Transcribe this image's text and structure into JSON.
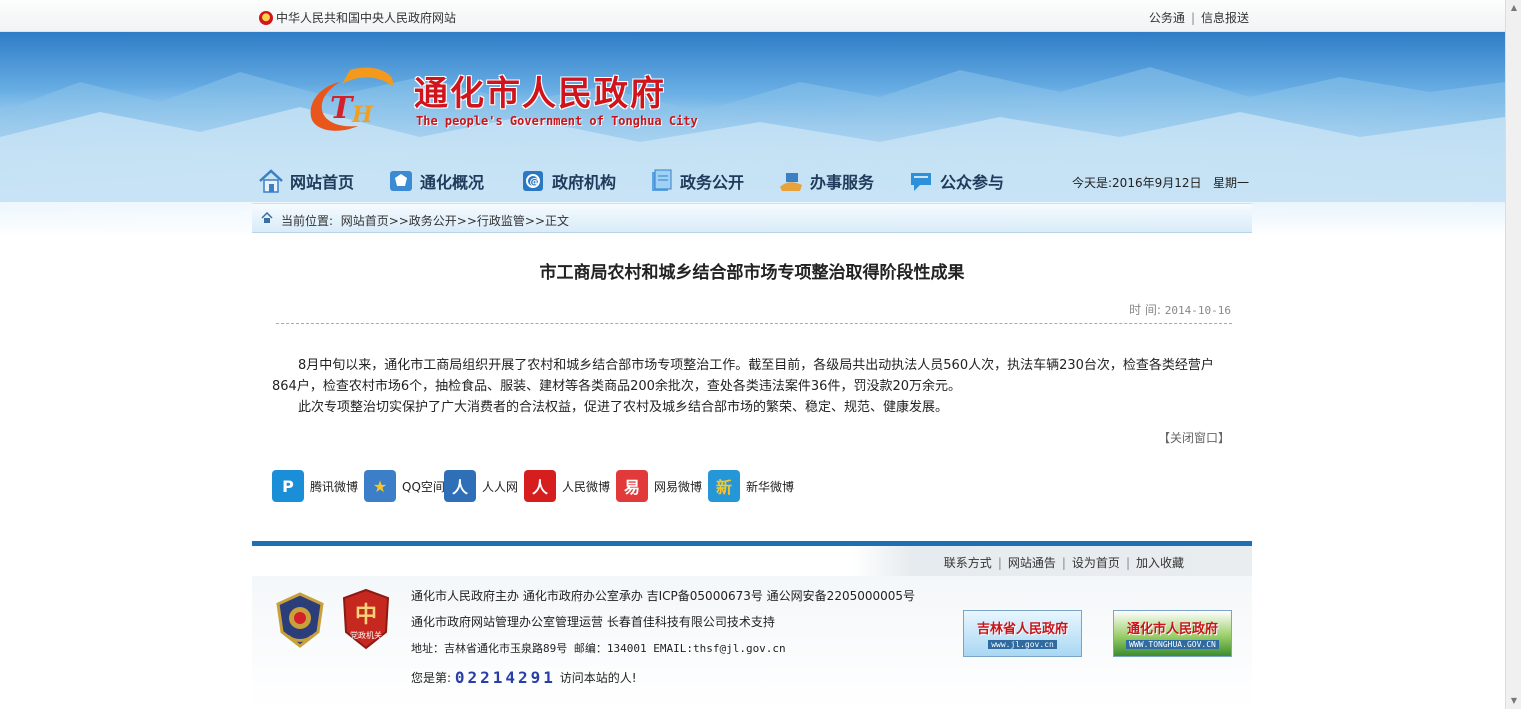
{
  "topbar": {
    "left_text": "中华人民共和国中央人民政府网站",
    "right_links": [
      "公务通",
      "信息报送"
    ]
  },
  "header": {
    "title": "通化市人民政府",
    "subtitle": "The people's Government of Tonghua City"
  },
  "nav": {
    "items": [
      {
        "label": "网站首页",
        "icon": "home-icon"
      },
      {
        "label": "通化概况",
        "icon": "overview-icon"
      },
      {
        "label": "政府机构",
        "icon": "institution-icon"
      },
      {
        "label": "政务公开",
        "icon": "document-icon"
      },
      {
        "label": "办事服务",
        "icon": "service-icon"
      },
      {
        "label": "公众参与",
        "icon": "chat-icon"
      }
    ],
    "date_label": "今天是:2016年9月12日",
    "weekday": "星期一"
  },
  "breadcrumb": {
    "prefix": "当前位置:",
    "path": "网站首页>>政务公开>>行政监管>>正文"
  },
  "article": {
    "title": "市工商局农村和城乡结合部市场专项整治取得阶段性成果",
    "time_label": "时 间:",
    "time_value": "2014-10-16",
    "paragraphs": [
      "8月中旬以来，通化市工商局组织开展了农村和城乡结合部市场专项整治工作。截至目前，各级局共出动执法人员560人次，执法车辆230台次，检查各类经营户864户，检查农村市场6个，抽检食品、服装、建材等各类商品200余批次，查处各类违法案件36件，罚没款20万余元。",
      "此次专项整治切实保护了广大消费者的合法权益，促进了农村及城乡结合部市场的繁荣、稳定、规范、健康发展。"
    ],
    "close_label": "【关闭窗口】"
  },
  "share": [
    {
      "label": "腾讯微博",
      "color": "#1b8ed8",
      "glyph": "P"
    },
    {
      "label": "QQ空间",
      "color": "#f0b21a",
      "glyph": "★"
    },
    {
      "label": "人人网",
      "color": "#2e6fb8",
      "glyph": "人"
    },
    {
      "label": "人民微博",
      "color": "#d71e1e",
      "glyph": "人"
    },
    {
      "label": "网易微博",
      "color": "#e23a3a",
      "glyph": "易"
    },
    {
      "label": "新华微博",
      "color": "#2596d8",
      "glyph": "新"
    }
  ],
  "footer": {
    "links": [
      "联系方式",
      "网站通告",
      "设为首页",
      "加入收藏"
    ],
    "line1": "通化市人民政府主办 通化市政府办公室承办 吉ICP备05000673号 通公网安备2205000005号",
    "line2": "通化市政府网站管理办公室管理运营 长春首佳科技有限公司技术支持",
    "line3": "地址：吉林省通化市玉泉路89号 邮编：134001 EMAIL:thsf@jl.gov.cn",
    "counter_prefix": "您是第:",
    "counter_value": "02214291",
    "counter_suffix": "访问本站的人!",
    "badge2_text": "党政机关",
    "banners": [
      {
        "title": "吉林省人民政府",
        "url": "www.jl.gov.cn"
      },
      {
        "title": "通化市人民政府",
        "url": "WWW.TONGHUA.GOV.CN"
      }
    ]
  }
}
